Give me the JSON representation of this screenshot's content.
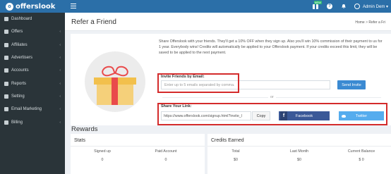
{
  "brand": {
    "logo_letter": "o",
    "name": "offerslook"
  },
  "topbar": {
    "gift_badge": "NEW",
    "help_symbol": "?",
    "admin_label": "Admin Dem",
    "user_caret": "▾"
  },
  "sidebar": {
    "items": [
      {
        "label": "Dashboard",
        "icon": "dashboard-icon",
        "arrow": ""
      },
      {
        "label": "Offers",
        "icon": "gift-icon",
        "arrow": "‹"
      },
      {
        "label": "Affiliates",
        "icon": "users-icon",
        "arrow": "‹"
      },
      {
        "label": "Advertisers",
        "icon": "user-tie-icon",
        "arrow": "‹"
      },
      {
        "label": "Accounts",
        "icon": "user-icon",
        "arrow": "‹"
      },
      {
        "label": "Reports",
        "icon": "chart-icon",
        "arrow": "‹"
      },
      {
        "label": "Setting",
        "icon": "gear-icon",
        "arrow": "‹"
      },
      {
        "label": "Email Marketing",
        "icon": "envelope-icon",
        "arrow": "‹"
      },
      {
        "label": "Billing",
        "icon": "billing-icon",
        "arrow": "‹"
      }
    ]
  },
  "page": {
    "title": "Refer a Friend",
    "breadcrumb_home": "Home",
    "breadcrumb_sep": ">",
    "breadcrumb_current": "Refer a Fri"
  },
  "refer": {
    "description": "Share Offerslook with your friends. They'll get a 10% OFF when they sign up. Also you'll win 10% commission of their payment to us for 1 year. Everybody wins! Credits will automatically be applied to your Offerslook payment. If your credits exceed this limit, they will be saved to be applied to the next payment.",
    "invite_label": "Invite Friends by Email:",
    "invite_placeholder": "Enter up to 5 emails separated by comma.",
    "send_button": "Send Invite",
    "or_text": "or",
    "share_label": "Share Your Link:",
    "share_link": "https://www.offerslook.com/signup.html?invite_l",
    "copy_button": "Copy",
    "facebook_button": "Facebook",
    "facebook_glyph": "f",
    "twitter_button": "Twitter"
  },
  "rewards": {
    "title": "Rewards",
    "stats": {
      "title": "Stats",
      "columns": [
        {
          "label": "Signed up",
          "value": "0"
        },
        {
          "label": "Paid Account",
          "value": "0"
        }
      ]
    },
    "credits": {
      "title": "Credits Earned",
      "columns": [
        {
          "label": "Total",
          "value": "$0"
        },
        {
          "label": "Last Month",
          "value": "$0"
        },
        {
          "label": "Current Balance",
          "value": "$ 0"
        }
      ]
    }
  },
  "colors": {
    "topbar": "#2b6fa8",
    "sidebar": "#2a3439",
    "highlight": "#d42b2b",
    "send_button": "#3b8ad2",
    "facebook": "#3b5998",
    "twitter": "#55acee"
  }
}
